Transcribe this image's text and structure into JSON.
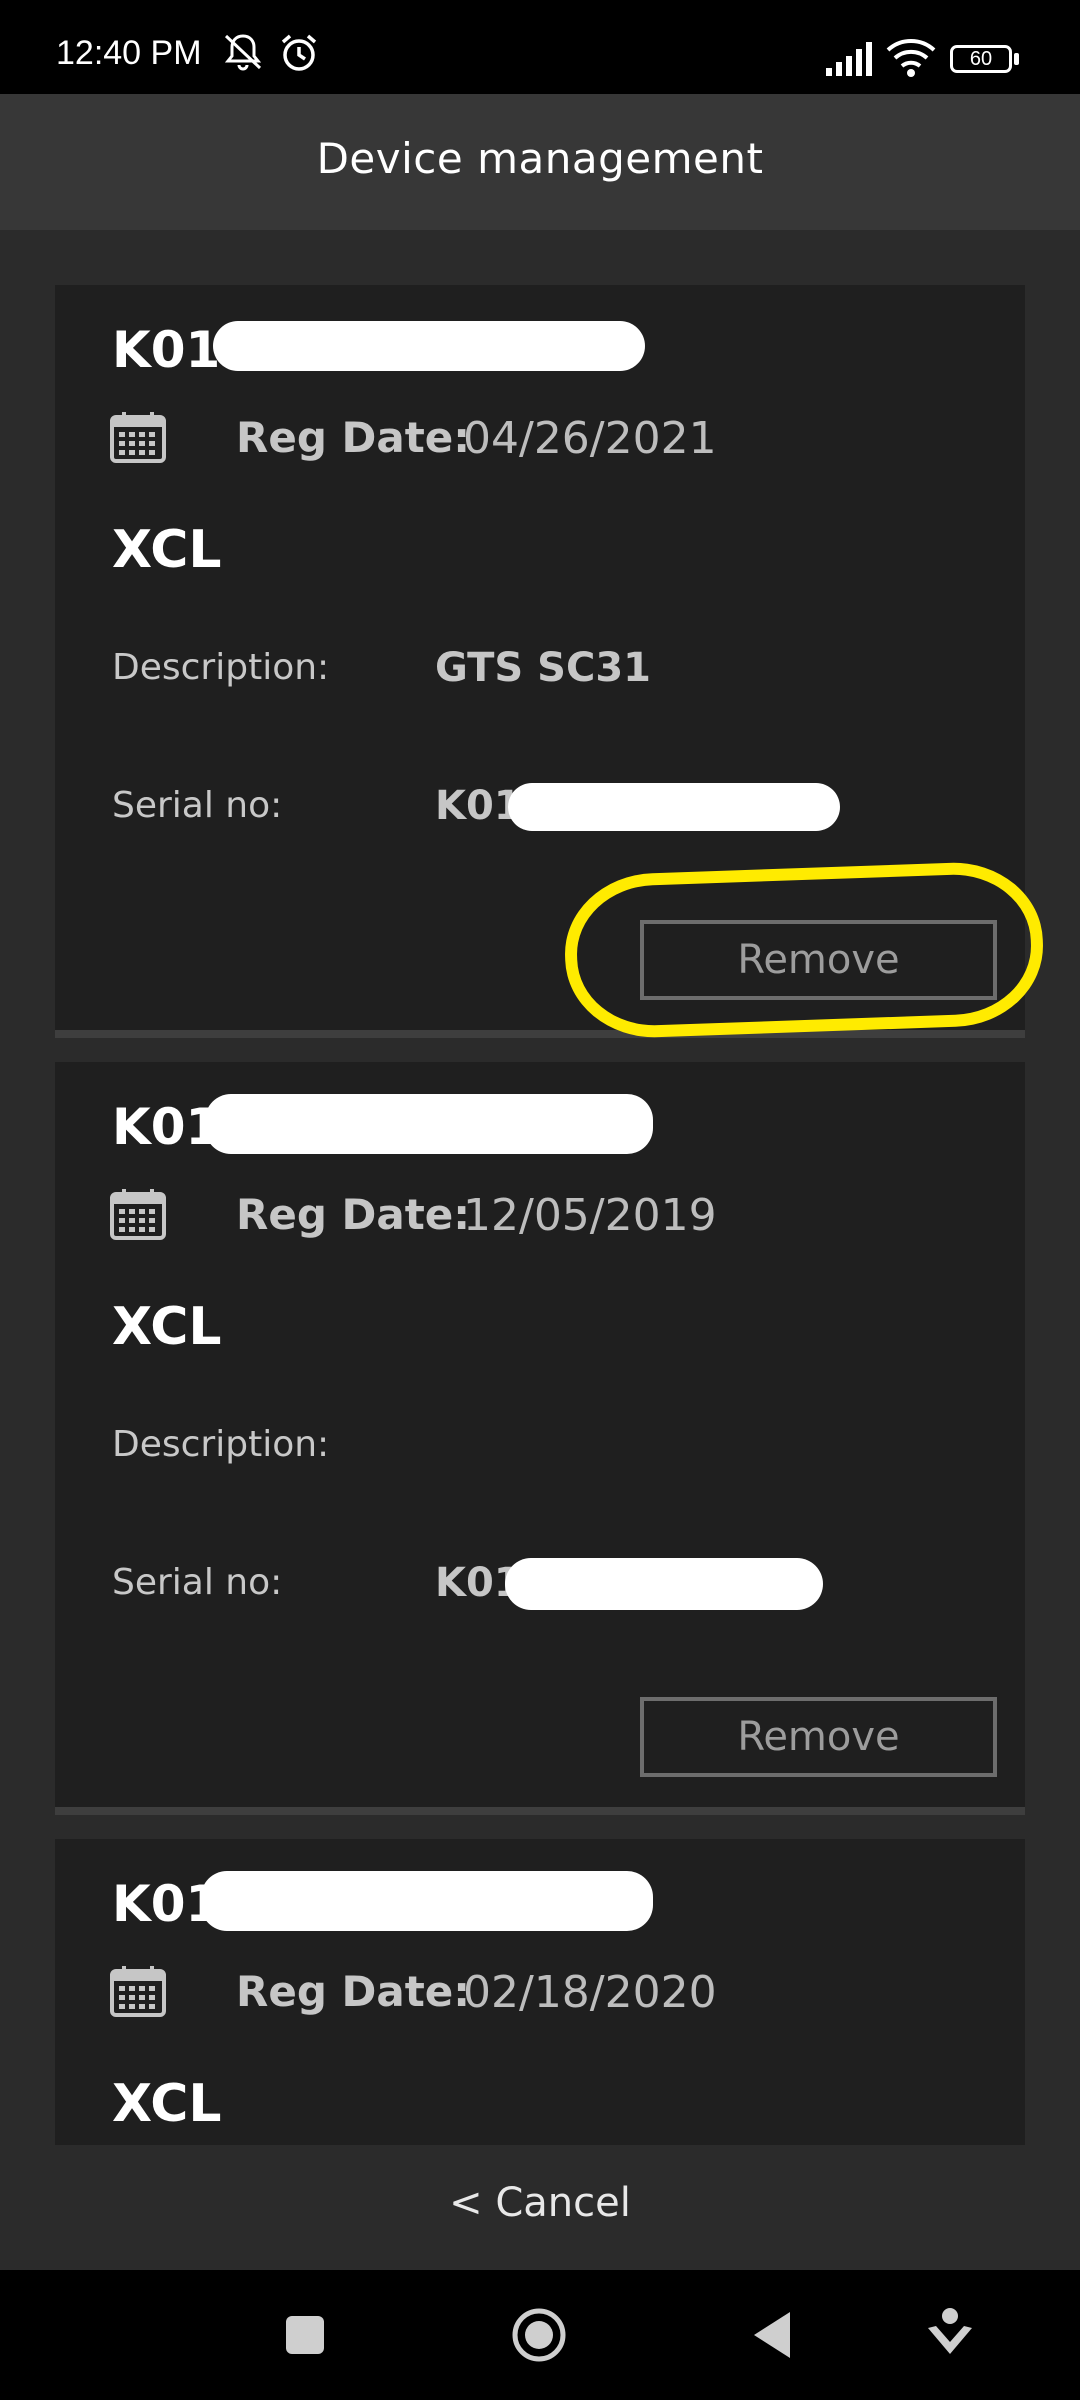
{
  "status_bar": {
    "time": "12:40 PM",
    "battery": "60",
    "icons": [
      "bell-off-icon",
      "alarm-icon",
      "signal-icon",
      "wifi-icon",
      "battery-icon"
    ]
  },
  "header": {
    "title": "Device management"
  },
  "devices": [
    {
      "serial_head": "K01",
      "reg_label": "Reg Date:",
      "reg_date": "04/26/2021",
      "model": "XCL",
      "description_label": "Description:",
      "description": "GTS SC31",
      "serial_label": "Serial no:",
      "serial": "K01",
      "remove_label": "Remove"
    },
    {
      "serial_head": "K01",
      "reg_label": "Reg Date:",
      "reg_date": "12/05/2019",
      "model": "XCL",
      "description_label": "Description:",
      "description": "",
      "serial_label": "Serial no:",
      "serial": "K01",
      "remove_label": "Remove"
    },
    {
      "serial_head": "K01",
      "reg_label": "Reg Date:",
      "reg_date": "02/18/2020",
      "model": "XCL"
    }
  ],
  "footer": {
    "cancel_label": "< Cancel"
  },
  "annotation": {
    "highlight_color": "#ffeb00"
  },
  "nav_bar": {
    "icons": [
      "recents-icon",
      "home-icon",
      "back-icon",
      "assist-icon"
    ]
  }
}
